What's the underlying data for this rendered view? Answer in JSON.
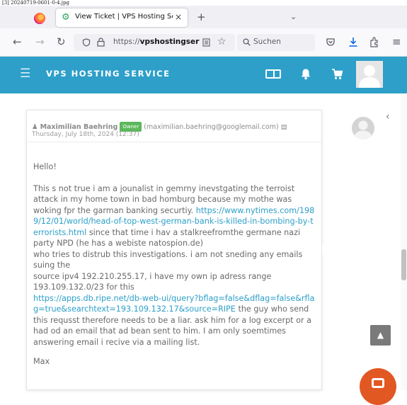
{
  "caption": "[3] 20240719-0601-0-4.jpg",
  "browser": {
    "tab_title": "View Ticket | VPS Hosting Servic",
    "url_prefix": "https://",
    "url_domain": "vpshostingserv",
    "search_placeholder": "Suchen",
    "new_tab": "+",
    "tab_close": "×"
  },
  "site": {
    "brand": "VPS HOSTING SERVICE"
  },
  "message": {
    "author": "Maximilian Baehring",
    "badge": "Owner",
    "email": "(maximilian.baehring@googlemail.com)",
    "date": "Thursday, July 18th, 2024 (12:37)",
    "greeting": "Hello!",
    "p1_a": "This s not true i am a jounalist in gemrny inevstgating the terroist attack in my home town in bad homburg because my mothe was woking fpr the garman banking securtiy. ",
    "link1": "https://www.nytimes.com/1989/12/01/world/head-of-top-west-german-bank-is-killed-in-bombing-by-terrorists.html",
    "p1_b": " since that time i hav a stalkreefromthe germane nazi party NPD (he has a webiste natospion.de)",
    "p1_c": "who tries to distrub this investigations. i am not sneding any emails suing the",
    "p1_d": "source ipv4 192.210.255.17, i have my own ip adress range 193.109.132.0/23 for this",
    "link2": "https://apps.db.ripe.net/db-web-ui/query?bflag=false&dflag=false&rflag=true&searchtext=193.109.132.17&source=RIPE",
    "p1_e": " the guy who send this requsst therefore needs to be a liar. ask him for a log excerpt or a had od an email that ad bean sent to him. I am only soemtimes answering email i recive via a mailing list.",
    "signature": "Max"
  },
  "icons": {
    "back": "←",
    "forward": "→",
    "reload": "↻",
    "back_to_top": "▲",
    "collapse": "‹"
  },
  "colors": {
    "header": "#2d9fc9",
    "link": "#2d9fc9",
    "badge": "#5cb85c",
    "chat": "#e25822"
  }
}
